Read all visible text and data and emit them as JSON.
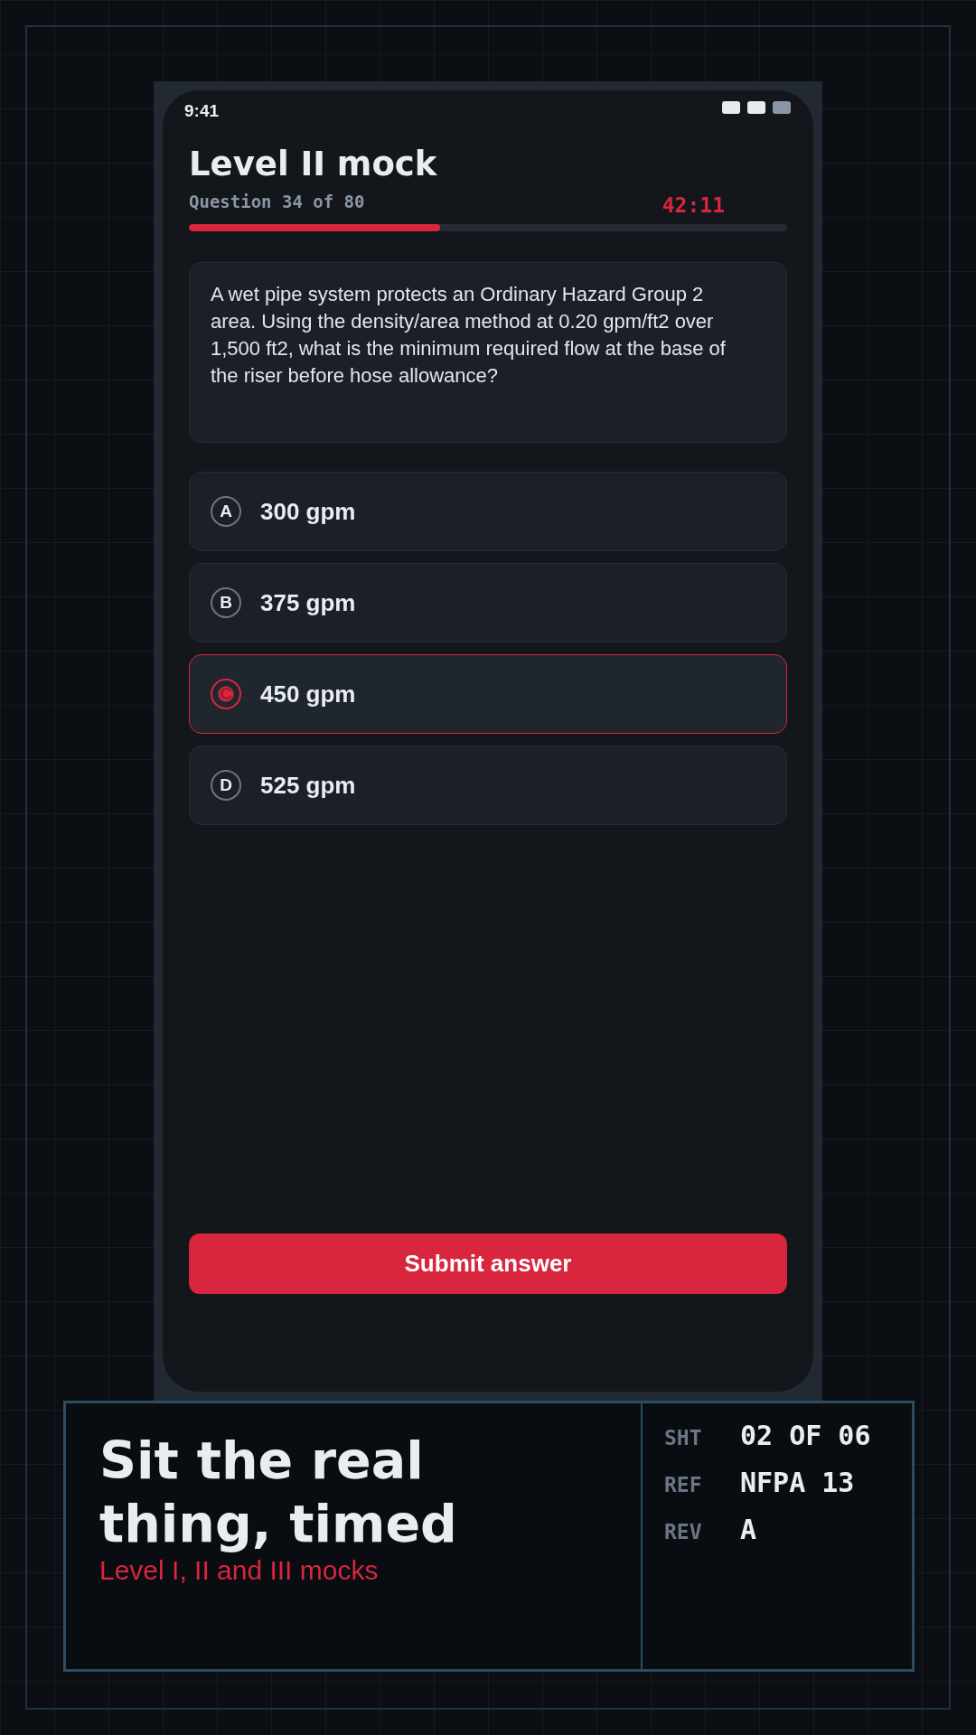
{
  "status_bar": {
    "time": "9:41"
  },
  "header": {
    "title": "Level II mock",
    "subtitle": "Question 34 of 80",
    "timer": "42:11",
    "progress": {
      "level": 0.42
    }
  },
  "question": "A wet pipe system protects an Ordinary Hazard Group 2 area. Using the density/area method at 0.20 gpm/ft2 over 1,500 ft2, what is the minimum required flow at the base of the riser before hose allowance?",
  "options": [
    {
      "letter": "A",
      "text": "300 gpm",
      "selected": false
    },
    {
      "letter": "B",
      "text": "375 gpm",
      "selected": false
    },
    {
      "letter": "C",
      "text": "450 gpm",
      "selected": true
    },
    {
      "letter": "D",
      "text": "525 gpm",
      "selected": false
    }
  ],
  "submit_button": "Submit answer",
  "title_block": {
    "headline": [
      "Sit the real",
      "thing, timed"
    ],
    "tagline": "Level I, II and III mocks",
    "fields": [
      {
        "label": "SHT",
        "value": "02 OF 06"
      },
      {
        "label": "REF",
        "value": "NFPA 13"
      },
      {
        "label": "REV",
        "value": "A"
      }
    ]
  }
}
